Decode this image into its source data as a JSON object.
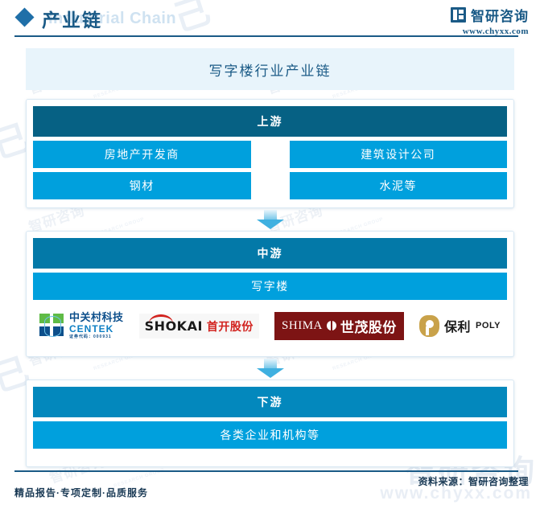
{
  "header": {
    "diamond_icon": "diamond-icon",
    "title_cn": "产业链",
    "title_en": "Industrial Chain",
    "brand": "智研咨询",
    "url": "www.chyxx.com"
  },
  "chart_title": "写字楼行业产业链",
  "sections": {
    "upstream": {
      "heading": "上游",
      "row1": [
        "房地产开发商",
        "建筑设计公司"
      ],
      "row2": [
        "钢材",
        "水泥等"
      ]
    },
    "midstream": {
      "heading": "中游",
      "bar": "写字楼",
      "companies": [
        {
          "id": "centek",
          "name_cn": "中关村科技",
          "name_en": "CENTEK",
          "code": "证券代码：000931"
        },
        {
          "id": "shokai",
          "name_en": "SHOKAI",
          "name_cn": "首开股份"
        },
        {
          "id": "shimao",
          "name_en": "SHIMA",
          "name_cn": "世茂股份"
        },
        {
          "id": "poly",
          "name_cn": "保利",
          "name_en": "POLY"
        }
      ]
    },
    "downstream": {
      "heading": "下游",
      "bar": "各类企业和机构等"
    }
  },
  "arrows": {
    "arrow1": "down-arrow-icon",
    "arrow2": "down-arrow-icon"
  },
  "footer": {
    "left": "精品报告·专项定制·品质服务",
    "right": "资料来源：智研咨询整理"
  },
  "watermarks": {
    "brand": "智研咨询",
    "url": "www.chyxx.com",
    "research_group": "RESEARCH GROUP"
  },
  "colors": {
    "section_header": "#066184",
    "item_bar": "#00a0dd",
    "title_bg": "#e8f4fb",
    "brand_blue": "#1a5a86"
  }
}
